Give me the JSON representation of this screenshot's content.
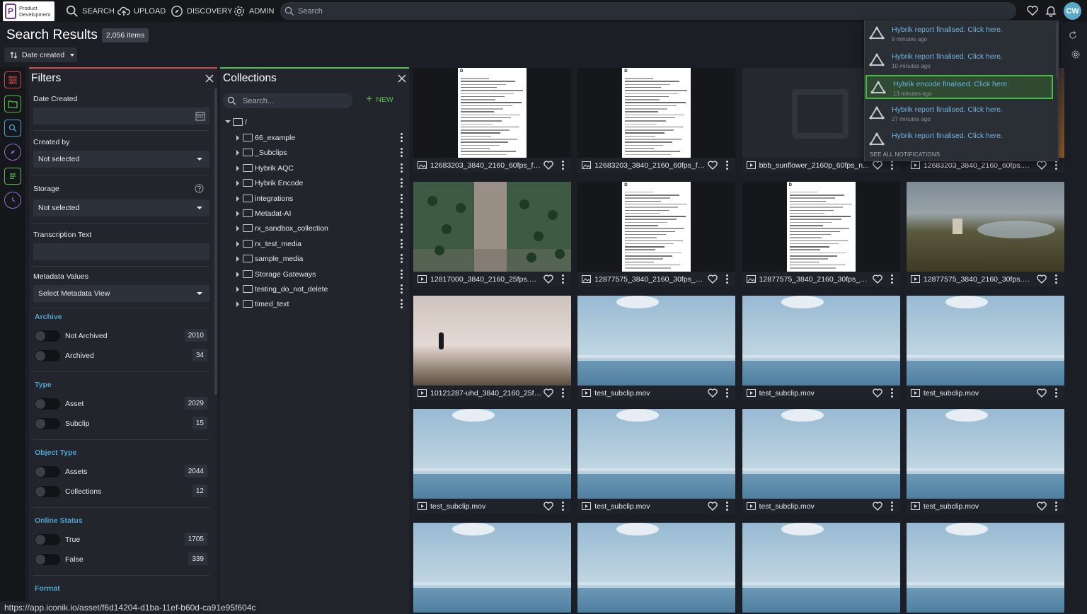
{
  "brand": {
    "logo_line1": "Product",
    "logo_line2": "Development"
  },
  "nav": {
    "search": "SEARCH",
    "upload": "UPLOAD",
    "discovery": "DISCOVERY",
    "admin": "ADMIN"
  },
  "top_search": {
    "placeholder": "Search"
  },
  "user": {
    "initials": "CW"
  },
  "results": {
    "title": "Search Results",
    "count": "2,056 items",
    "sort_label": "Date created"
  },
  "filters": {
    "title": "Filters",
    "date_created_label": "Date Created",
    "created_by_label": "Created by",
    "created_by_value": "Not selected",
    "storage_label": "Storage",
    "storage_value": "Not selected",
    "transcription_label": "Transcription Text",
    "metadata_label": "Metadata Values",
    "metadata_value": "Select Metadata View",
    "sections": [
      {
        "title": "Archive",
        "rows": [
          {
            "label": "Not Archived",
            "count": "2010"
          },
          {
            "label": "Archived",
            "count": "34"
          }
        ]
      },
      {
        "title": "Type",
        "rows": [
          {
            "label": "Asset",
            "count": "2029"
          },
          {
            "label": "Subclip",
            "count": "15"
          }
        ]
      },
      {
        "title": "Object Type",
        "rows": [
          {
            "label": "Assets",
            "count": "2044"
          },
          {
            "label": "Collections",
            "count": "12"
          }
        ]
      },
      {
        "title": "Online Status",
        "rows": [
          {
            "label": "True",
            "count": "1705"
          },
          {
            "label": "False",
            "count": "339"
          }
        ]
      },
      {
        "title": "Format",
        "rows": []
      }
    ]
  },
  "collections": {
    "title": "Collections",
    "search_placeholder": "Search...",
    "new_label": "NEW",
    "root": "/",
    "folders": [
      "66_example",
      "_Subclips",
      "Hybrik AQC",
      "Hybrik Encode",
      "integrations",
      "Metadat-AI",
      "rx_sandbox_collection",
      "rx_test_media",
      "sample_media",
      "Storage Gateways",
      "testing_do_not_delete",
      "timed_text"
    ]
  },
  "assets": [
    {
      "name": "12683203_3840_2160_60fps_f6f...",
      "kind": "image",
      "thumb": "doc"
    },
    {
      "name": "12683203_3840_2160_60fps_f6f...",
      "kind": "image",
      "thumb": "doc"
    },
    {
      "name": "bbb_sunflower_2160p_60fps_n...",
      "kind": "video",
      "thumb": "dark"
    },
    {
      "name": "12683203_3840_2160_60fps.mp4",
      "kind": "video",
      "thumb": "autumn"
    },
    {
      "name": "12817000_3840_2160_25fps.mp4",
      "kind": "video",
      "thumb": "aerial"
    },
    {
      "name": "12877575_3840_2160_30fps_64...",
      "kind": "image",
      "thumb": "doc"
    },
    {
      "name": "12877575_3840_2160_30fps_64...",
      "kind": "image",
      "thumb": "doc"
    },
    {
      "name": "12877575_3840_2160_30fps.mp4",
      "kind": "video",
      "thumb": "castle"
    },
    {
      "name": "10121287-uhd_3840_2160_25fp...",
      "kind": "video",
      "thumb": "beach"
    },
    {
      "name": "test_subclip.mov",
      "kind": "video",
      "thumb": "sea"
    },
    {
      "name": "test_subclip.mov",
      "kind": "video",
      "thumb": "sea"
    },
    {
      "name": "test_subclip.mov",
      "kind": "video",
      "thumb": "sea"
    },
    {
      "name": "test_subclip.mov",
      "kind": "video",
      "thumb": "sea"
    },
    {
      "name": "test_subclip.mov",
      "kind": "video",
      "thumb": "sea"
    },
    {
      "name": "test_subclip.mov",
      "kind": "video",
      "thumb": "sea"
    },
    {
      "name": "test_subclip.mov",
      "kind": "video",
      "thumb": "sea"
    },
    {
      "name": "",
      "kind": "video",
      "thumb": "sea"
    },
    {
      "name": "",
      "kind": "video",
      "thumb": "sea"
    },
    {
      "name": "",
      "kind": "video",
      "thumb": "sea"
    },
    {
      "name": "",
      "kind": "video",
      "thumb": "sea"
    }
  ],
  "notifications": {
    "items": [
      {
        "title": "Hybrik report finalised. Click here.",
        "time": "9 minutes ago",
        "active": false
      },
      {
        "title": "Hybrik report finalised. Click here.",
        "time": "10 minutes ago",
        "active": false
      },
      {
        "title": "Hybrik encode finalised. Click here.",
        "time": "13 minutes ago",
        "active": true
      },
      {
        "title": "Hybrik report finalised. Click here.",
        "time": "27 minutes ago",
        "active": false
      },
      {
        "title": "Hybrik report finalised. Click here.",
        "time": "",
        "active": false
      }
    ],
    "see_all": "SEE ALL NOTIFICATIONS"
  },
  "status_url": "https://app.iconik.io/asset/f6d14204-d1ba-11ef-b60d-ca91e95f604c",
  "colors": {
    "accent_blue": "#4fa3d1",
    "filters_accent": "#d24a4a",
    "collections_accent": "#5bbf4e",
    "notif_active": "#3fbf3f"
  }
}
